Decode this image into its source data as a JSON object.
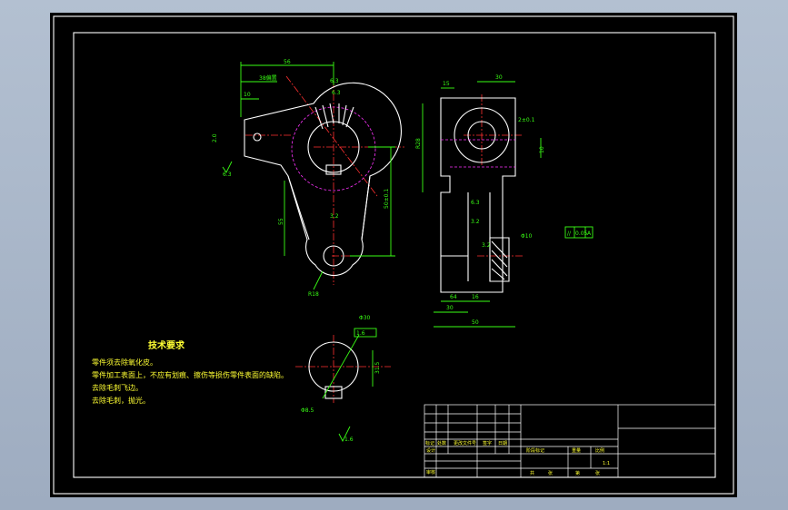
{
  "colors": {
    "background": "#000000",
    "outline": "#ffffff",
    "dimension": "#39ff14",
    "centerline": "#ff3030",
    "hidden": "#ff33ff",
    "text": "#ffff33"
  },
  "tech_requirements": {
    "title": "技术要求",
    "lines": [
      "零件须去除氧化皮。",
      "零件加工表面上，不应有划痕、擦伤等损伤零件表面的缺陷。",
      "去除毛刺飞边。",
      "去除毛刺，抛光。"
    ]
  },
  "dims_front": {
    "d1": "56",
    "d2": "38偏置",
    "d3": "10",
    "d4": "6.3",
    "d5": "6.3",
    "d6": "2.0",
    "d7": "6.3",
    "d8": "3.2",
    "d9": "55",
    "d10": "50±0.1",
    "d11": "R18"
  },
  "dims_side": {
    "d1": "15",
    "d2": "30",
    "d3": "2±0.1",
    "d4": "10",
    "d5": "R28",
    "d6": "6.3",
    "d7": "3.2",
    "d8": "3.2",
    "d9": "Φ10",
    "d10": "64",
    "d11": "16",
    "d12": "30",
    "d13": "50"
  },
  "tolerance_frame": {
    "symbol": "//",
    "value": "0.05",
    "datum": "A"
  },
  "dims_section": {
    "d1": "Φ30",
    "d2": "1.6",
    "d3": "31.5",
    "d4": "Φ8.5",
    "d5": "1.6"
  },
  "title_block": {
    "labels": [
      "标记",
      "处数",
      "更改文件号",
      "签字",
      "日期",
      "设计",
      "审核",
      "阶段标记",
      "重量",
      "比例",
      "共",
      "张",
      "第",
      "张"
    ],
    "scale": "1:1"
  }
}
